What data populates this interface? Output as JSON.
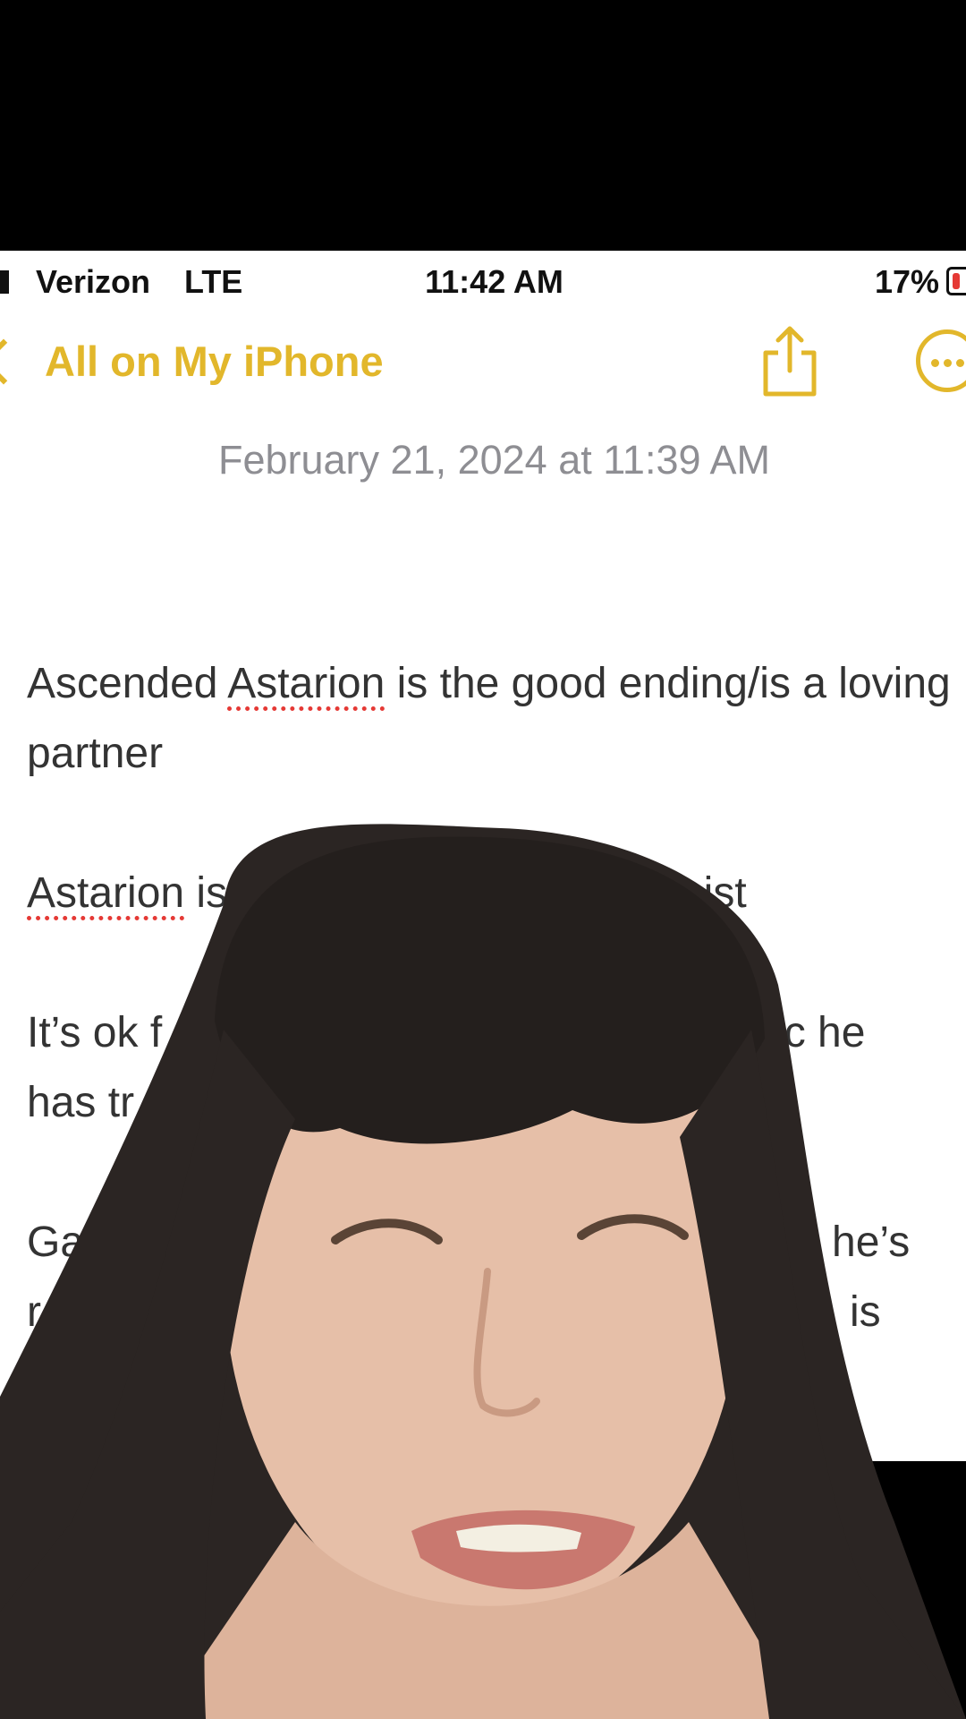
{
  "status_bar": {
    "carrier": "Verizon",
    "network": "LTE",
    "time": "11:42 AM",
    "battery": "17%"
  },
  "nav": {
    "back_label": "All on My iPhone",
    "share_icon": "share-icon",
    "more_icon": "ellipsis-circle-icon",
    "accent_color": "#e2b72b"
  },
  "note": {
    "date": "February 21, 2024 at 11:39 AM",
    "p1_a": "Ascended ",
    "p1_b": "Astarion",
    "p1_c": " is the good ending/is a loving partner",
    "p2_a": "Astarion",
    "p2_b": " is ju",
    "p2_c": "racist",
    "p3_a": "It’s ok f",
    "p3_b": "bc he",
    "p3_c": "has tr",
    "p4_a": "Ga",
    "p4_b": "he’s",
    "p4_c": "r",
    "p4_d": "is"
  }
}
